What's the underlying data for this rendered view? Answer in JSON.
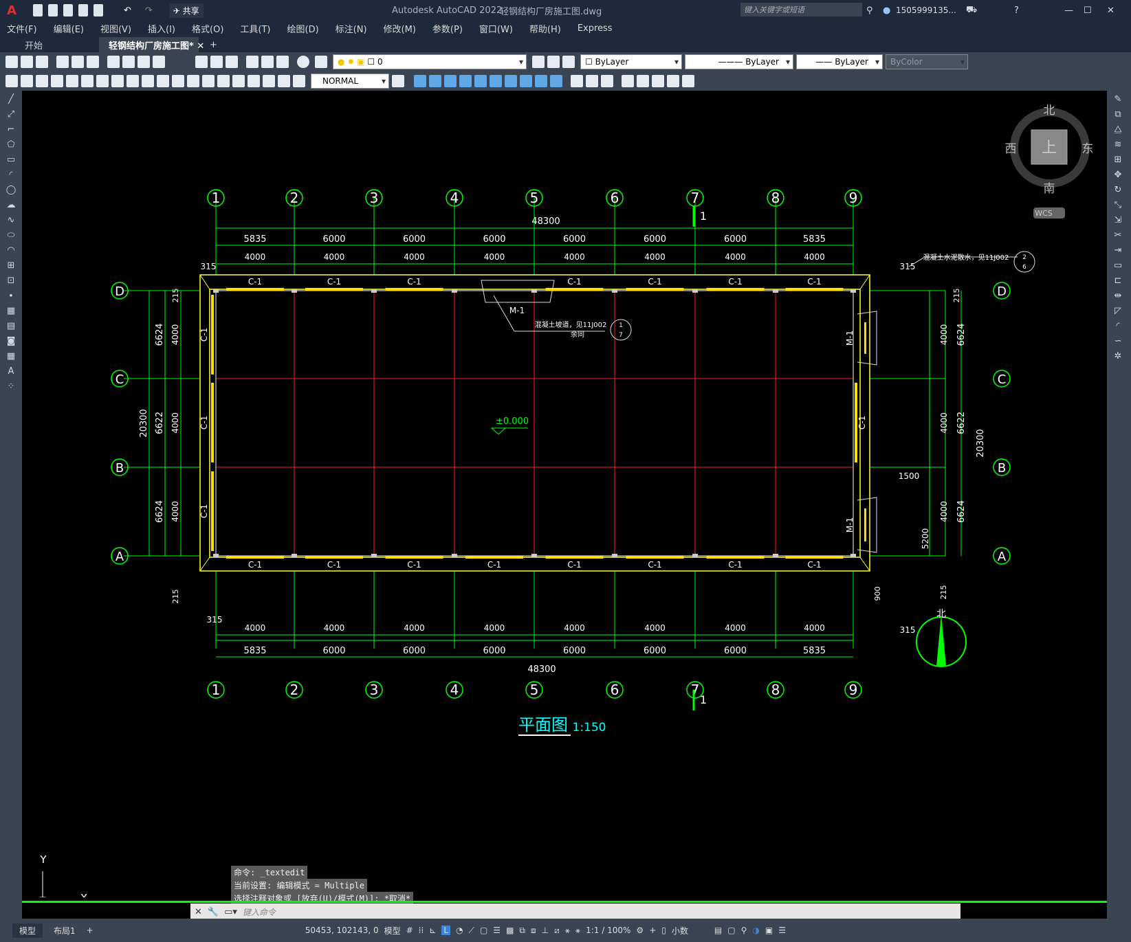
{
  "titlebar": {
    "app_title": "Autodesk AutoCAD 2022",
    "file_name": "轻钢结构厂房施工图.dwg",
    "share_label": "共享",
    "search_placeholder": "键入关键字或短语",
    "user": "1505999135..."
  },
  "menu": [
    "文件(F)",
    "编辑(E)",
    "视图(V)",
    "插入(I)",
    "格式(O)",
    "工具(T)",
    "绘图(D)",
    "标注(N)",
    "修改(M)",
    "参数(P)",
    "窗口(W)",
    "帮助(H)",
    "Express"
  ],
  "tabs": [
    {
      "label": "开始"
    },
    {
      "label": "轻钢结构厂房施工图*"
    }
  ],
  "toolbar": {
    "layer": "0",
    "color": "ByLayer",
    "linetype": "ByLayer",
    "lineweight": "ByLayer",
    "plotstyle": "ByColor",
    "dimstyle": "NORMAL"
  },
  "viewcube": {
    "north": "北",
    "south": "南",
    "east": "东",
    "west": "西",
    "top": "上",
    "wcs": "WCS"
  },
  "drawing": {
    "grid_cols": [
      "1",
      "2",
      "3",
      "4",
      "5",
      "6",
      "7",
      "8",
      "9"
    ],
    "grid_rows": [
      "D",
      "C",
      "B",
      "A"
    ],
    "overall_width": "48300",
    "bay_dims": [
      "5835",
      "6000",
      "6000",
      "6000",
      "6000",
      "6000",
      "6000",
      "5835"
    ],
    "overall_depth": "20300",
    "side_dims": [
      "6624",
      "6622",
      "6624"
    ],
    "window_label": "C-1",
    "door_label": "M-1",
    "elevation": "±0.000",
    "section_mark": "1",
    "title": "平面图",
    "scale": "1:150",
    "note_ramp": "混凝土坡道，见11J002",
    "note_ramp2": "余同",
    "note_apron": "混凝土水泥散水，见11J002",
    "north_label": "北",
    "dim_1500": "1500",
    "dim_5200": "5200",
    "dim_900": "900",
    "dim_315": "315",
    "dim_215": "215"
  },
  "command_history": [
    "命令: _textedit",
    "当前设置: 编辑模式 = Multiple",
    "选择注释对象或 [放弃(U)/模式(M)]: *取消*"
  ],
  "command_placeholder": "键入命令",
  "ucs": {
    "x": "X",
    "y": "Y"
  },
  "layout_tabs": [
    "模型",
    "布局1"
  ],
  "status": {
    "coords": "50453, 102143, 0",
    "space": "模型",
    "scale": "1:1 / 100%",
    "units": "小数"
  }
}
